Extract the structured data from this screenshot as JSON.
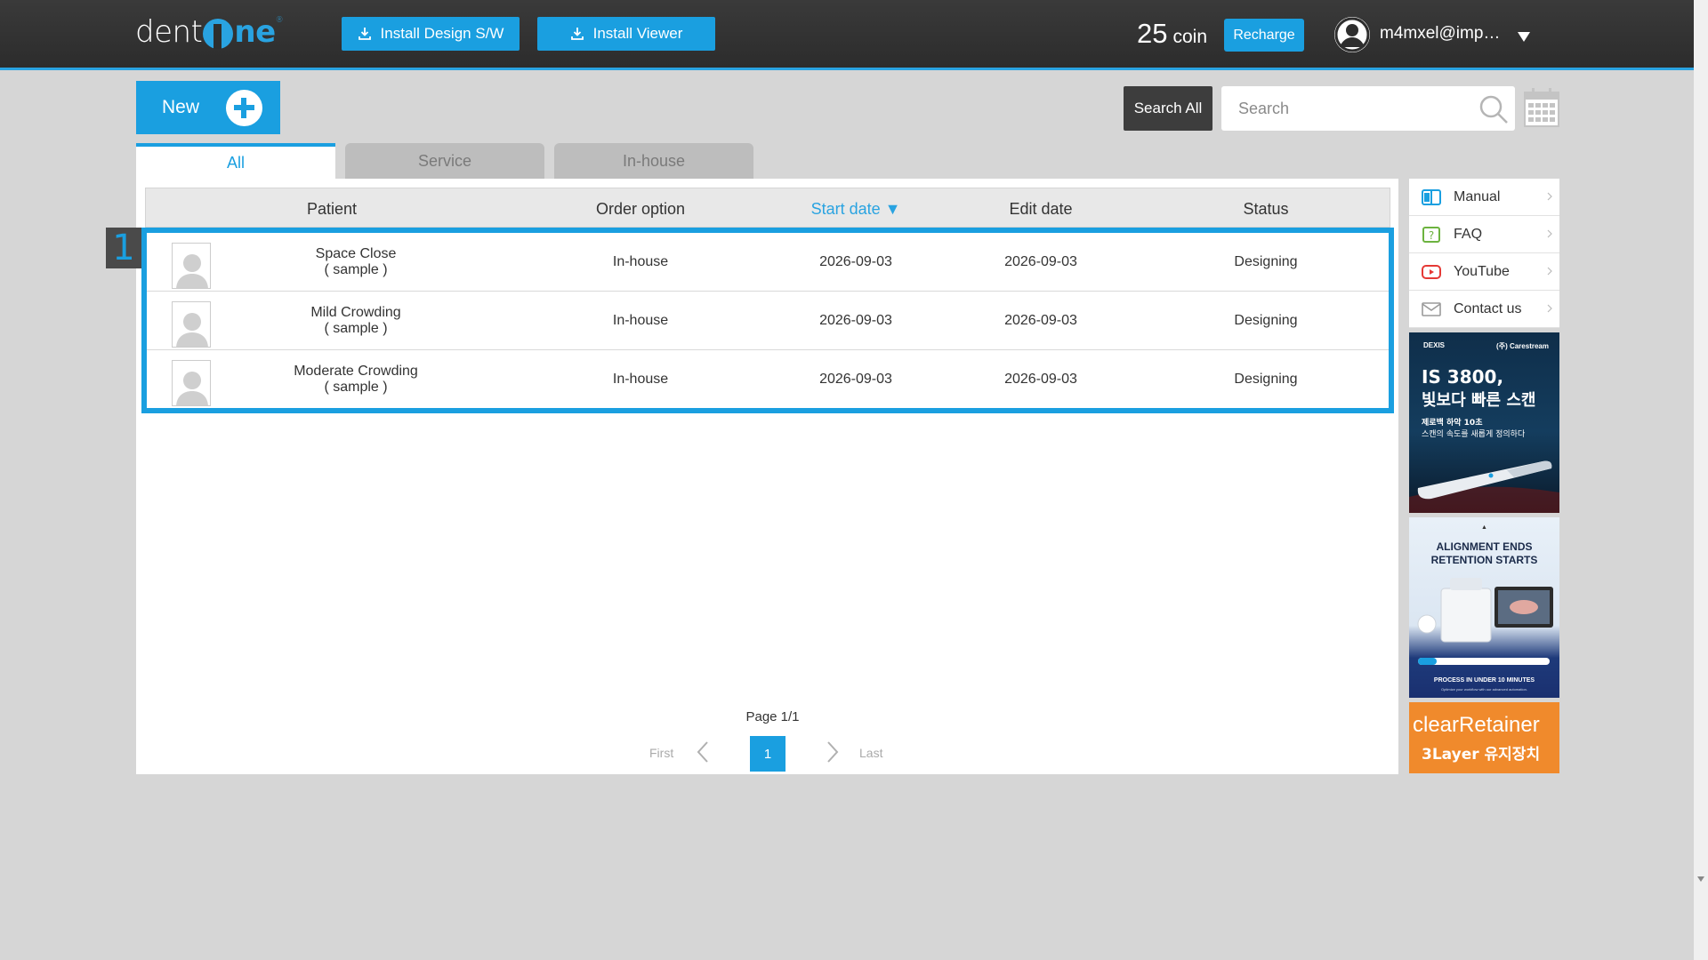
{
  "header": {
    "logo_text": "dent",
    "logo_one": "ne",
    "install_design": "Install Design S/W",
    "install_viewer": "Install Viewer",
    "coin_count": "25",
    "coin_unit": "coin",
    "recharge": "Recharge",
    "user": "m4mxel@imp…"
  },
  "toolbar": {
    "new_label": "New",
    "search_all": "Search All",
    "search_placeholder": "Search"
  },
  "tabs": [
    {
      "label": "All",
      "active": true
    },
    {
      "label": "Service",
      "active": false
    },
    {
      "label": "In-house",
      "active": false
    }
  ],
  "table": {
    "columns": [
      "Patient",
      "Order option",
      "Start date ▼",
      "Edit date",
      "Status"
    ],
    "selection_number": "1",
    "rows": [
      {
        "patient": "Space Close",
        "patient_sub": "( sample )",
        "order_option": "In-house",
        "start_date": "2026-09-03",
        "edit_date": "2026-09-03",
        "status": "Designing"
      },
      {
        "patient": "Mild Crowding",
        "patient_sub": "( sample )",
        "order_option": "In-house",
        "start_date": "2026-09-03",
        "edit_date": "2026-09-03",
        "status": "Designing"
      },
      {
        "patient": "Moderate Crowding",
        "patient_sub": "( sample )",
        "order_option": "In-house",
        "start_date": "2026-09-03",
        "edit_date": "2026-09-03",
        "status": "Designing"
      }
    ]
  },
  "pagination": {
    "info": "Page 1/1",
    "first": "First",
    "last": "Last",
    "current": "1"
  },
  "side_menu": [
    {
      "label": "Manual",
      "icon": "book-icon"
    },
    {
      "label": "FAQ",
      "icon": "question-icon"
    },
    {
      "label": "YouTube",
      "icon": "youtube-icon"
    },
    {
      "label": "Contact us",
      "icon": "mail-icon"
    }
  ],
  "ads": {
    "ad1_brand_left": "DEXIS",
    "ad1_brand_right": "(주) Carestream",
    "ad1_title": "IS 3800,",
    "ad1_title2": "빛보다 빠른 스캔",
    "ad1_sub1": "제로백 하악 10초",
    "ad1_sub2": "스캔의 속도를 새롭게 정의하다",
    "ad2_title1": "ALIGNMENT ENDS",
    "ad2_title2": "RETENTION STARTS",
    "ad2_bar": "PROCESS IN UNDER 10 MINUTES",
    "ad2_small": "Optimize your workflow with our advanced automation.",
    "ad3_title": "clearRetainer",
    "ad3_sub": "3Layer 유지장치"
  },
  "colors": {
    "accent": "#1a9fe0",
    "header_bg": "#2e2e2e",
    "page_bg": "#d6d6d6"
  }
}
